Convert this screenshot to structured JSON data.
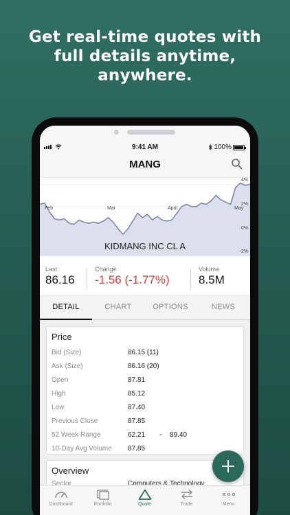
{
  "promo": {
    "line1": "Get real-time quotes with",
    "line2": "full details anytime,",
    "line3": "anywhere."
  },
  "status": {
    "time": "9:41 AM",
    "battery": "100%"
  },
  "header": {
    "title": "MANG",
    "search_icon": "search-icon"
  },
  "chart_data": {
    "type": "area",
    "title": "KIDMANG INC CL A",
    "x_tick_labels": [
      "Feb",
      "Mar",
      "April",
      "May"
    ],
    "y_tick_labels": [
      "4%",
      "2%",
      "0%",
      "-2%"
    ],
    "series": [
      {
        "values": [
          2.2,
          2.3,
          1.5,
          0.9,
          0.8,
          0.9,
          0.5,
          0.4,
          0.8,
          0.6,
          0.5,
          0.6,
          0.5,
          0.7,
          1.0,
          0.6,
          0.0,
          -0.5,
          0.0,
          0.7,
          1.4,
          1.0,
          1.3,
          0.8,
          1.1,
          0.8,
          0.7,
          0.8,
          1.4,
          2.0,
          2.2,
          2.0,
          2.0,
          2.3,
          2.2,
          2.5,
          3.0,
          2.6,
          2.4,
          2.2,
          3.7,
          4.1,
          3.9,
          4.0
        ]
      }
    ],
    "color": "#7b8aa8",
    "fill": "#cfd6e6"
  },
  "stats": {
    "last_label": "Last",
    "last_value": "86.16",
    "change_label": "Change",
    "change_value": "-1.56 (-1.77%)",
    "volume_label": "Volume",
    "volume_value": "8.5M"
  },
  "tabs": [
    "DETAIL",
    "CHART",
    "OPTIONS",
    "NEWS"
  ],
  "price": {
    "heading": "Price",
    "rows": [
      {
        "label": "Bid (Size)",
        "value": "86.15 (11)"
      },
      {
        "label": "Ask (Size)",
        "value": "86.16 (20)"
      },
      {
        "label": "Open",
        "value": "87.81"
      },
      {
        "label": "High",
        "value": "85.12"
      },
      {
        "label": "Low",
        "value": "87.40"
      },
      {
        "label": "Previous Close",
        "value": "87.85"
      },
      {
        "label": "52 Week Range",
        "value": "62.21",
        "sep": "-",
        "value2": "89.40"
      },
      {
        "label": "10-Day Avg Volume",
        "value": "87.85"
      }
    ]
  },
  "overview": {
    "heading": "Overview",
    "sector_label": "Sector",
    "sector_value": "Computers & Technology"
  },
  "bottom_tabs": [
    {
      "label": "Dashboard",
      "icon": "gauge-icon"
    },
    {
      "label": "Portfolio",
      "icon": "portfolio-icon"
    },
    {
      "label": "Quote",
      "icon": "triangle-icon"
    },
    {
      "label": "Trade",
      "icon": "arrows-icon"
    },
    {
      "label": "Menu",
      "icon": "dots-icon"
    }
  ],
  "colors": {
    "accent": "#2b6a5b",
    "negative": "#d0403a",
    "background": "#2f6f61"
  }
}
